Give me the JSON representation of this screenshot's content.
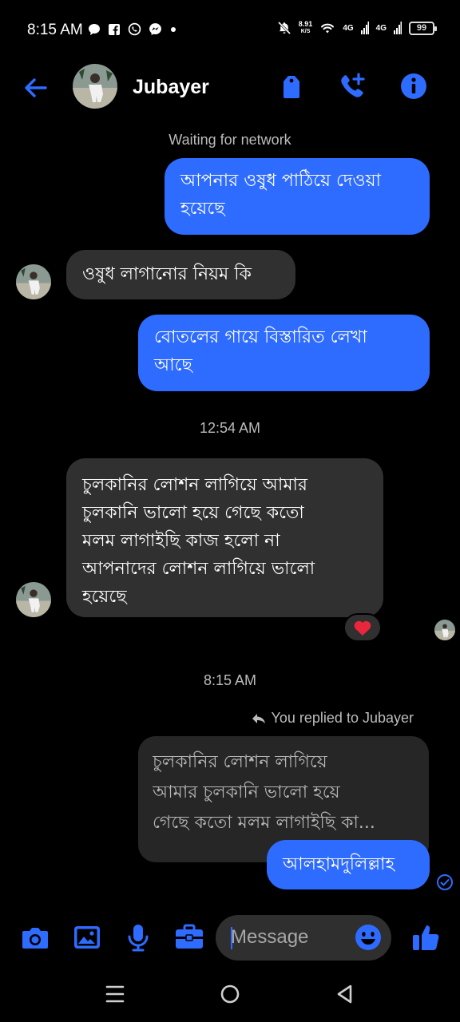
{
  "status_bar": {
    "time": "8:15 AM",
    "net_speed_value": "8.91",
    "net_speed_unit": "K/S",
    "signal1": "4G",
    "signal2": "4G",
    "battery": "99"
  },
  "header": {
    "contact_name": "Jubayer"
  },
  "chat": {
    "waiting_text": "Waiting for network",
    "messages": [
      {
        "lines": [
          "আপনার ওষুধ পাঠিয়ে দেওয়া",
          "হয়েছে"
        ]
      },
      {
        "lines": [
          "ওষুধ লাগানোর নিয়ম কি"
        ]
      },
      {
        "lines": [
          "বোতলের গায়ে বিস্তারিত লেখা",
          "আছে"
        ]
      },
      {
        "lines": [
          "চুলকানির লোশন লাগিয়ে আমার",
          "চুলকানি ভালো হয়ে গেছে কতো",
          "মলম লাগাইছি কাজ হলো না",
          "আপনাদের লোশন লাগিয়ে ভালো",
          "হয়েছে"
        ]
      }
    ],
    "time1": "12:54 AM",
    "time2": "8:15 AM",
    "reaction": "heart",
    "replied_label": "You replied to Jubayer",
    "quoted_lines": [
      "চুলকানির লোশন লাগিয়ে",
      "আমার চুলকানি ভালো হয়ে",
      "গেছে কতো  মলম লাগাইছি কা..."
    ],
    "reply_text": "আলহামদুলিল্লাহ"
  },
  "composer": {
    "placeholder": "Message"
  },
  "colors": {
    "accent": "#2e6bff",
    "incoming_bubble": "#303030",
    "background": "#000000"
  },
  "icons": [
    "back-arrow-icon",
    "tag-icon",
    "add-call-icon",
    "info-icon",
    "camera-icon",
    "image-icon",
    "mic-icon",
    "briefcase-icon",
    "emoji-icon",
    "thumbs-up-icon",
    "heart-icon",
    "reply-arrow-icon",
    "seen-check-icon"
  ]
}
